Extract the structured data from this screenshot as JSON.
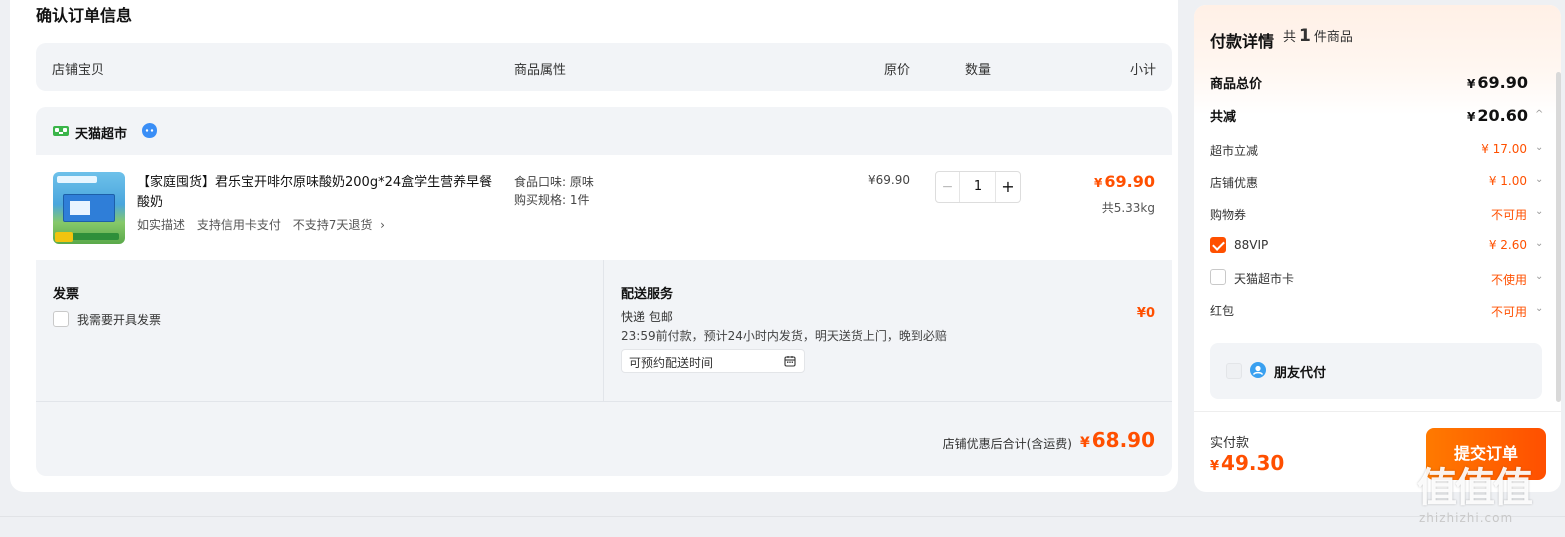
{
  "page": {
    "title": "确认订单信息"
  },
  "table_header": {
    "shop_item": "店铺宝贝",
    "attributes": "商品属性",
    "orig_price": "原价",
    "quantity": "数量",
    "subtotal": "小计"
  },
  "shop": {
    "name": "天猫超市"
  },
  "item": {
    "title": "【家庭囤货】君乐宝开啡尔原味酸奶200g*24盒学生营养早餐酸奶",
    "tags": [
      "如实描述",
      "支持信用卡支付",
      "不支持7天退货"
    ],
    "tag_chevron": "›",
    "sku_flavor": "食品口味: 原味",
    "sku_spec": "购买规格: 1件",
    "orig_price": "¥69.90",
    "qty": "1",
    "minus": "−",
    "plus": "+",
    "subtotal_cur": "¥",
    "subtotal": "69.90",
    "weight": "共5.33kg"
  },
  "invoice": {
    "title": "发票",
    "label": "我需要开具发票",
    "checked": false
  },
  "delivery": {
    "title": "配送服务",
    "method": "快递 包邮",
    "note": "23:59前付款，预计24小时内发货，明天送货上门，晚到必赔",
    "time_label": "可预约配送时间",
    "fee": "¥0"
  },
  "shop_total": {
    "label": "店铺优惠后合计(含运费)",
    "cur": "¥",
    "value": "68.90"
  },
  "pay": {
    "title": "付款详情",
    "count_prefix": "共",
    "count": "1",
    "count_suffix": "件商品",
    "rows": [
      {
        "label": "商品总价",
        "cur": "¥",
        "value": "69.90"
      },
      {
        "label": "共减",
        "cur": "¥",
        "value": "20.60",
        "chev": "^"
      },
      {
        "label": "超市立减",
        "value": "¥ 17.00",
        "chev": "⌄"
      },
      {
        "label": "店铺优惠",
        "value": "¥ 1.00",
        "chev": "⌄"
      },
      {
        "label": "购物券",
        "value": "不可用",
        "chev": "⌄"
      },
      {
        "label": "88VIP",
        "value": "¥ 2.60",
        "chev": "⌄",
        "checked": true
      },
      {
        "label": "天猫超市卡",
        "value": "不使用",
        "chev": "⌄",
        "checked": false
      },
      {
        "label": "红包",
        "value": "不可用",
        "chev": "⌄"
      }
    ],
    "friend_pay": "朋友代付",
    "actual_label": "实付款",
    "actual_cur": "¥",
    "actual_value": "49.30",
    "submit": "提交订单"
  },
  "watermark": {
    "big": "值值值",
    "small": "zhizhizhi.com"
  },
  "colors": {
    "accent": "#ff5000",
    "price": "#ff4f00",
    "panel_bg": "#f2f4f7"
  }
}
